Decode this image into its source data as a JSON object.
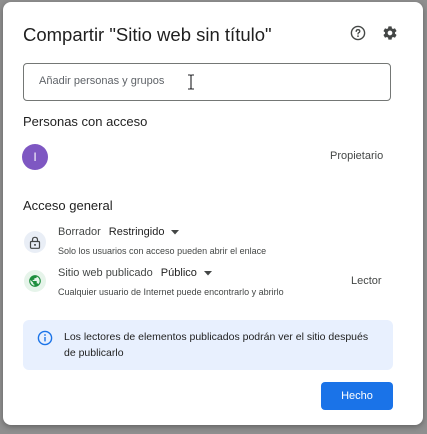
{
  "dialog": {
    "title": "Compartir \"Sitio web sin título\""
  },
  "icons": {
    "help": "help-circle-icon",
    "settings": "gear-icon"
  },
  "search": {
    "placeholder": "Añadir personas y grupos",
    "value": ""
  },
  "people": {
    "section_title": "Personas con acceso",
    "owner": {
      "avatar_letter": "I",
      "avatar_color": "#7e57c2",
      "role": "Propietario"
    }
  },
  "general_access": {
    "section_title": "Acceso general",
    "draft": {
      "name": "Borrador",
      "level": "Restringido",
      "description": "Solo los usuarios con acceso pueden abrir el enlace"
    },
    "published": {
      "name": "Sitio web publicado",
      "level": "Público",
      "description": "Cualquier usuario de Internet puede encontrarlo y abrirlo",
      "role": "Lector"
    }
  },
  "info": {
    "text": "Los lectores de elementos publicados podrán ver el sitio después de publicarlo"
  },
  "footer": {
    "done_label": "Hecho"
  },
  "colors": {
    "accent": "#1a73e8",
    "info_bg": "#e8f0fe",
    "public_green": "#1e8e3e"
  }
}
